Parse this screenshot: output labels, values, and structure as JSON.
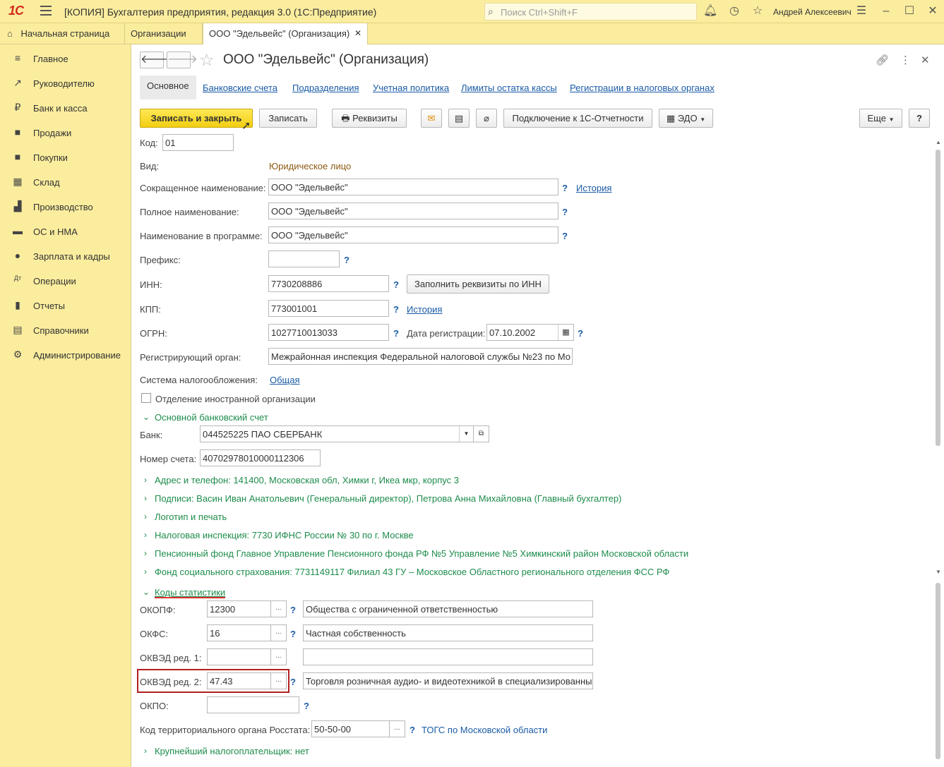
{
  "titlebar": {
    "logo": "1С",
    "app_title": "[КОПИЯ] Бухгалтерия предприятия, редакция 3.0  (1С:Предприятие)",
    "search_placeholder": "Поиск Ctrl+Shift+F",
    "user_name": "Андрей Алексеевич"
  },
  "tabs": [
    {
      "label": "Начальная страница"
    },
    {
      "label": "Организации"
    },
    {
      "label": "ООО \"Эдельвейс\" (Организация)"
    }
  ],
  "sidebar": {
    "items": [
      {
        "label": "Главное",
        "icon": "≡"
      },
      {
        "label": "Руководителю",
        "icon": "↗"
      },
      {
        "label": "Банк и касса",
        "icon": "₽"
      },
      {
        "label": "Продажи",
        "icon": "■"
      },
      {
        "label": "Покупки",
        "icon": "■"
      },
      {
        "label": "Склад",
        "icon": "▦"
      },
      {
        "label": "Производство",
        "icon": "▟"
      },
      {
        "label": "ОС и НМА",
        "icon": "▬"
      },
      {
        "label": "Зарплата и кадры",
        "icon": "●"
      },
      {
        "label": "Операции",
        "icon": "Дт"
      },
      {
        "label": "Отчеты",
        "icon": "▮"
      },
      {
        "label": "Справочники",
        "icon": "▤"
      },
      {
        "label": "Администрирование",
        "icon": "⚙"
      }
    ]
  },
  "form": {
    "title": "ООО \"Эдельвейс\" (Организация)",
    "tabs": [
      "Основное",
      "Банковские счета",
      "Подразделения",
      "Учетная политика",
      "Лимиты остатка кассы",
      "Регистрации в налоговых органах"
    ],
    "toolbar": {
      "save_close": "Записать и закрыть",
      "save": "Записать",
      "requisites": "Реквизиты",
      "connect": "Подключение к 1С-Отчетности",
      "edo": "ЭДО",
      "more": "Еще",
      "help": "?"
    },
    "kod_label": "Код:",
    "kod_value": "01",
    "vid_label": "Вид:",
    "vid_value": "Юридическое лицо",
    "short_name_label": "Сокращенное наименование:",
    "short_name_value": "ООО \"Эдельвейс\"",
    "history": "История",
    "full_name_label": "Полное наименование:",
    "full_name_value": "ООО \"Эдельвейс\"",
    "prog_name_label": "Наименование в программе:",
    "prog_name_value": "ООО \"Эдельвейс\"",
    "prefix_label": "Префикс:",
    "prefix_value": "",
    "inn_label": "ИНН:",
    "inn_value": "7730208886",
    "fill_by_inn": "Заполнить реквизиты по ИНН",
    "kpp_label": "КПП:",
    "kpp_value": "773001001",
    "ogrn_label": "ОГРН:",
    "ogrn_value": "1027710013033",
    "reg_date_label": "Дата регистрации:",
    "reg_date_value": "07.10.2002",
    "reg_organ_label": "Регистрирующий орган:",
    "reg_organ_value": "Межрайонная инспекция Федеральной налоговой службы №23 по Мо",
    "tax_system_label": "Система налогообложения:",
    "tax_system_value": "Общая",
    "foreign_branch": "Отделение иностранной организации",
    "bank_section": "Основной банковский счет",
    "bank_label": "Банк:",
    "bank_value": "044525225 ПАО СБЕРБАНК",
    "account_label": "Номер счета:",
    "account_value": "40702978010000112306",
    "collapsed": [
      "Адрес и телефон: 141400, Московская обл, Химки г, Икеа мкр, корпус 3",
      "Подписи: Васин Иван Анатольевич (Генеральный директор), Петрова Анна Михайловна (Главный бухгалтер)",
      "Логотип и печать",
      "Налоговая инспекция: 7730 ИФНС России № 30 по г. Москве",
      "Пенсионный фонд Главное Управление Пенсионного фонда РФ №5 Управление №5 Химкинский район Московской области",
      "Фонд социального страхования: 7731149117 Филиал 43 ГУ – Московское Областного регионального отделения ФСС РФ"
    ],
    "stat_section": "Коды статистики",
    "okopf_label": "ОКОПФ:",
    "okopf_code": "12300",
    "okopf_text": "Общества с ограниченной ответственностью",
    "okfs_label": "ОКФС:",
    "okfs_code": "16",
    "okfs_text": "Частная собственность",
    "okved1_label": "ОКВЭД ред. 1:",
    "okved1_code": "",
    "okved1_text": "",
    "okved2_label": "ОКВЭД ред. 2:",
    "okved2_code": "47.43",
    "okved2_text": "Торговля розничная аудио- и видеотехникой в специализированны",
    "okpo_label": "ОКПО:",
    "okpo_value": "",
    "rosstat_label": "Код территориального органа Росстата:",
    "rosstat_value": "50-50-00",
    "rosstat_link": "ТОГС по Московской области",
    "largest_taxpayer": "Крупнейший налогоплательщик: нет",
    "ellipsis": "...",
    "question": "?"
  }
}
